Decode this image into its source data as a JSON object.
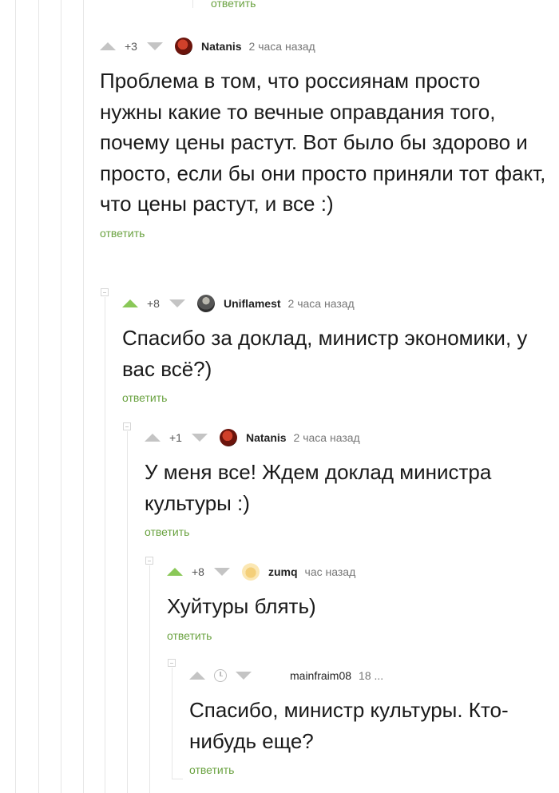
{
  "top": {
    "reply_label": "ответить"
  },
  "comments": [
    {
      "rating": "+3",
      "author": "Natanis",
      "time": "2 часа назад",
      "text": "Проблема в том, что россиянам просто нужны какие то вечные оправдания того, почему цены растут. Вот было бы здорово и просто, если бы они просто приняли тот факт, что цены растут, и все :)",
      "reply_label": "ответить"
    },
    {
      "rating": "+8",
      "author": "Uniflamest",
      "time": "2 часа назад",
      "text": "Спасибо за доклад, министр экономики, у вас всё?)",
      "reply_label": "ответить"
    },
    {
      "rating": "+1",
      "author": "Natanis",
      "time": "2 часа назад",
      "text": "У меня все! Ждем доклад министра культуры :)",
      "reply_label": "ответить"
    },
    {
      "rating": "+8",
      "author": "zumq",
      "time": "час назад",
      "text": "Хуйтуры блять)",
      "reply_label": "ответить"
    },
    {
      "rating": "",
      "author": "mainfraim08",
      "time": "18 ...",
      "text": "Спасибо, министр культуры. Кто-нибудь еще?",
      "reply_label": "ответить"
    }
  ],
  "colors": {
    "upvote_active": "#8ac858",
    "reply_link": "#6aa240"
  },
  "icons": [
    "arrow-up-icon",
    "arrow-down-icon",
    "clock-icon",
    "collapse-icon",
    "avatar"
  ]
}
